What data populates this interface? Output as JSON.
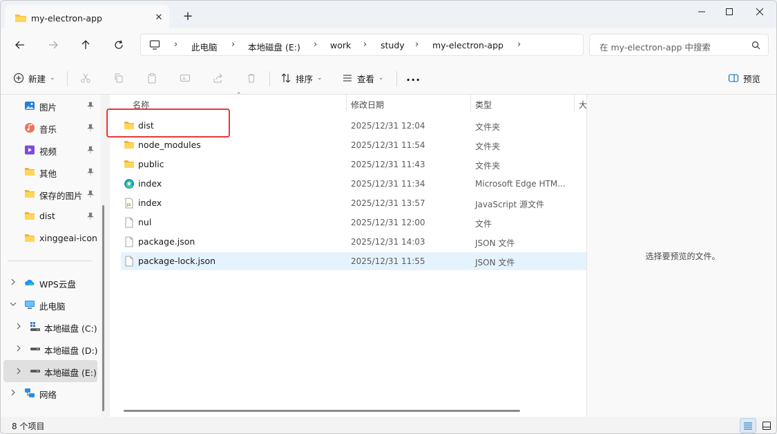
{
  "window": {
    "tab_title": "my-electron-app",
    "new_tab": "+",
    "close_tab": "✕"
  },
  "address": {
    "crumbs": [
      "此电脑",
      "本地磁盘 (E:)",
      "work",
      "study",
      "my-electron-app"
    ],
    "search_placeholder": "在 my-electron-app 中搜索"
  },
  "toolbar": {
    "new_label": "新建",
    "sort_label": "排序",
    "view_label": "查看",
    "more_label": "...",
    "preview_label": "预览"
  },
  "sidebar": {
    "pinned": [
      {
        "label": "图片",
        "icon": "pictures-icon"
      },
      {
        "label": "音乐",
        "icon": "music-icon"
      },
      {
        "label": "视频",
        "icon": "videos-icon"
      },
      {
        "label": "其他",
        "icon": "folder-icon"
      },
      {
        "label": "保存的图片",
        "icon": "folder-icon"
      },
      {
        "label": "dist",
        "icon": "folder-icon"
      }
    ],
    "unpinned": [
      {
        "label": "xinggeai-icon",
        "icon": "folder-icon"
      }
    ],
    "tree": [
      {
        "label": "WPS云盘",
        "icon": "cloud-icon"
      },
      {
        "label": "此电脑",
        "icon": "computer-icon"
      },
      {
        "label": "本地磁盘 (C:)",
        "icon": "drive-icon"
      },
      {
        "label": "本地磁盘 (D:)",
        "icon": "drive-icon"
      },
      {
        "label": "本地磁盘 (E:)",
        "icon": "drive-icon"
      },
      {
        "label": "网络",
        "icon": "network-icon"
      }
    ]
  },
  "columns": {
    "name": "名称",
    "modified": "修改日期",
    "type": "类型",
    "size": "大"
  },
  "files": [
    {
      "name": "dist",
      "date": "2025/12/31 12:04",
      "type": "文件夹",
      "icon": "folder-icon"
    },
    {
      "name": "node_modules",
      "date": "2025/12/31 11:54",
      "type": "文件夹",
      "icon": "folder-icon"
    },
    {
      "name": "public",
      "date": "2025/12/31 11:43",
      "type": "文件夹",
      "icon": "folder-icon"
    },
    {
      "name": "index",
      "date": "2025/12/31 11:34",
      "type": "Microsoft Edge HTM...",
      "icon": "edge-icon"
    },
    {
      "name": "index",
      "date": "2025/12/31 13:57",
      "type": "JavaScript 源文件",
      "icon": "js-file-icon"
    },
    {
      "name": "nul",
      "date": "2025/12/31 12:00",
      "type": "文件",
      "icon": "file-icon"
    },
    {
      "name": "package.json",
      "date": "2025/12/31 14:03",
      "type": "JSON 文件",
      "icon": "file-icon"
    },
    {
      "name": "package-lock.json",
      "date": "2025/12/31 11:55",
      "type": "JSON 文件",
      "icon": "file-icon"
    }
  ],
  "preview": {
    "message": "选择要预览的文件。"
  },
  "status": {
    "count": "8 个项目"
  },
  "colors": {
    "folder": "#f4c044",
    "selection": "#e5f3ff",
    "highlight": "#e53935",
    "accent": "#0067c0"
  }
}
